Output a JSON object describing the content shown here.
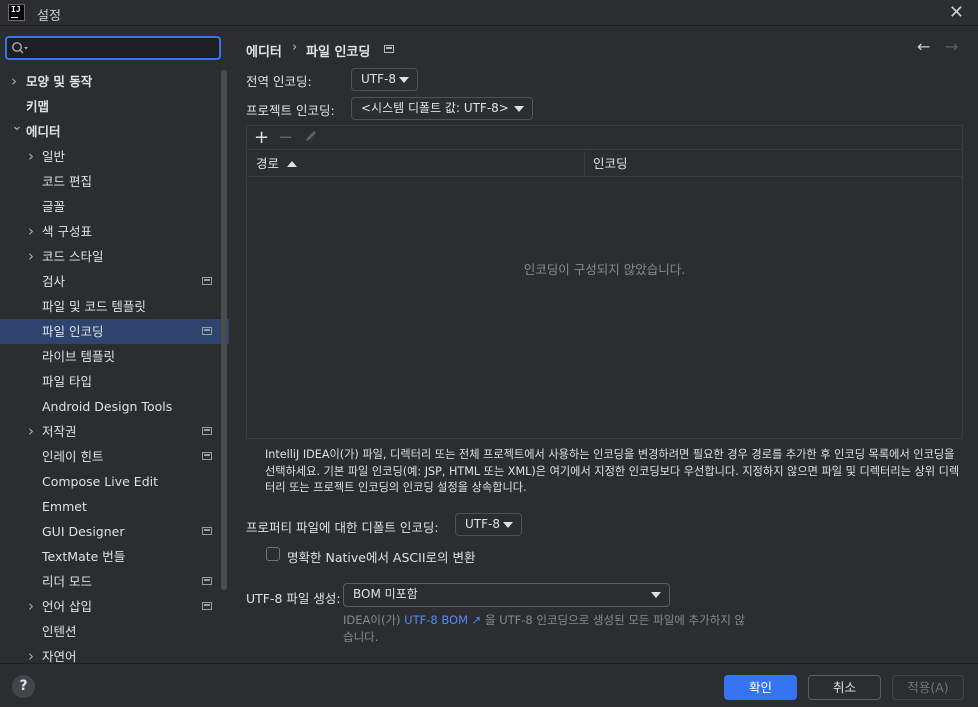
{
  "window": {
    "title": "설정",
    "app_icon_text": "IJ"
  },
  "search": {
    "placeholder": ""
  },
  "sidebar": {
    "items": [
      {
        "label": "모양 및 동작",
        "level": 0,
        "chevron": "right",
        "bold": true
      },
      {
        "label": "키맵",
        "level": 0,
        "chevron": "",
        "bold": true
      },
      {
        "label": "에디터",
        "level": 0,
        "chevron": "down",
        "bold": true
      },
      {
        "label": "일반",
        "level": 1,
        "chevron": "right"
      },
      {
        "label": "코드 편집",
        "level": 1,
        "chevron": ""
      },
      {
        "label": "글꼴",
        "level": 1,
        "chevron": ""
      },
      {
        "label": "색 구성표",
        "level": 1,
        "chevron": "right"
      },
      {
        "label": "코드 스타일",
        "level": 1,
        "chevron": "right"
      },
      {
        "label": "검사",
        "level": 1,
        "chevron": "",
        "project_icon": true
      },
      {
        "label": "파일 및 코드 템플릿",
        "level": 1,
        "chevron": ""
      },
      {
        "label": "파일 인코딩",
        "level": 1,
        "chevron": "",
        "project_icon": true,
        "selected": true
      },
      {
        "label": "라이브 템플릿",
        "level": 1,
        "chevron": ""
      },
      {
        "label": "파일 타입",
        "level": 1,
        "chevron": ""
      },
      {
        "label": "Android Design Tools",
        "level": 1,
        "chevron": ""
      },
      {
        "label": "저작권",
        "level": 1,
        "chevron": "right",
        "project_icon": true
      },
      {
        "label": "인레이 힌트",
        "level": 1,
        "chevron": "",
        "project_icon": true
      },
      {
        "label": "Compose Live Edit",
        "level": 1,
        "chevron": ""
      },
      {
        "label": "Emmet",
        "level": 1,
        "chevron": ""
      },
      {
        "label": "GUI Designer",
        "level": 1,
        "chevron": "",
        "project_icon": true
      },
      {
        "label": "TextMate 번들",
        "level": 1,
        "chevron": ""
      },
      {
        "label": "리더 모드",
        "level": 1,
        "chevron": "",
        "project_icon": true
      },
      {
        "label": "언어 삽입",
        "level": 1,
        "chevron": "right",
        "project_icon": true
      },
      {
        "label": "인텐션",
        "level": 1,
        "chevron": ""
      },
      {
        "label": "자연어",
        "level": 1,
        "chevron": "right"
      }
    ]
  },
  "breadcrumb": {
    "parent": "에디터",
    "separator": "›",
    "current": "파일 인코딩"
  },
  "nav_arrows": {
    "back": "←",
    "forward": "→"
  },
  "global_encoding": {
    "label": "전역 인코딩:",
    "value": "UTF-8"
  },
  "project_encoding": {
    "label": "프로젝트 인코딩:",
    "value": "<시스템 디폴트 값: UTF-8>"
  },
  "table": {
    "add_icon": "+",
    "remove_icon": "−",
    "columns": [
      "경로",
      "인코딩"
    ],
    "empty_text": "인코딩이 구성되지 않았습니다."
  },
  "description": "IntelliJ IDEA이(가) 파일, 디렉터리 또는 전체 프로젝트에서 사용하는 인코딩을 변경하려면 필요한 경우 경로를 추가한 후 인코딩 목록에서 인코딩을 선택하세요. 기본 파일 인코딩(예: JSP, HTML 또는 XML)은 여기에서 지정한 인코딩보다 우선합니다. 지정하지 않으면 파일 및 디렉터리는 상위 디렉터리 또는 프로젝트 인코딩의 인코딩 설정을 상속합니다.",
  "properties_encoding": {
    "label": "프로퍼티 파일에 대한 디폴트 인코딩:",
    "value": "UTF-8"
  },
  "native_ascii": {
    "label": "명확한 Native에서 ASCII로의 변환",
    "checked": false
  },
  "utf8_bom": {
    "label": "UTF-8 파일 생성:",
    "value": "BOM 미포함"
  },
  "bom_hint": {
    "prefix": "IDEA이(가) ",
    "link": "UTF-8 BOM ↗",
    "suffix": " 을 UTF-8 인코딩으로 생성된 모든 파일에 추가하지 않습니다."
  },
  "footer": {
    "help": "?",
    "ok": "확인",
    "cancel": "취소",
    "apply": "적용(A)"
  },
  "colors": {
    "accent": "#3574f0",
    "selection": "#2e436e",
    "link": "#548af7",
    "background": "#2b2d30"
  }
}
